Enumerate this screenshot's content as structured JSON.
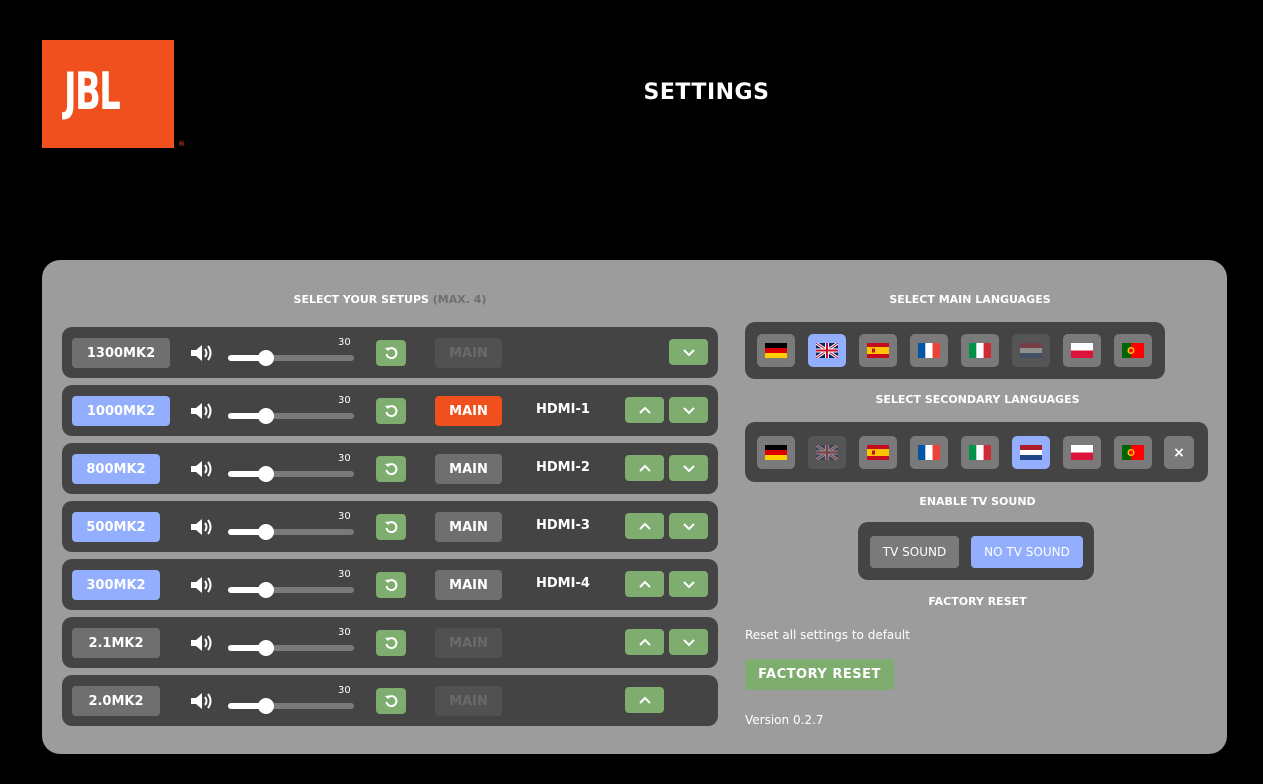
{
  "brand": {
    "logo_text": "JBL",
    "registered": "®"
  },
  "header": {
    "title": "SETTINGS"
  },
  "setups": {
    "title": "SELECT YOUR SETUPS",
    "title_note": "(MAX. 4)",
    "rows": [
      {
        "model": "1300MK2",
        "active": false,
        "volume": 30,
        "main_label": "MAIN",
        "main_state": "disabled",
        "hdmi": "",
        "up": false,
        "down": true
      },
      {
        "model": "1000MK2",
        "active": true,
        "volume": 30,
        "main_label": "MAIN",
        "main_state": "active",
        "hdmi": "HDMI-1",
        "up": true,
        "down": true
      },
      {
        "model": "800MK2",
        "active": true,
        "volume": 30,
        "main_label": "MAIN",
        "main_state": "normal",
        "hdmi": "HDMI-2",
        "up": true,
        "down": true
      },
      {
        "model": "500MK2",
        "active": true,
        "volume": 30,
        "main_label": "MAIN",
        "main_state": "normal",
        "hdmi": "HDMI-3",
        "up": true,
        "down": true
      },
      {
        "model": "300MK2",
        "active": true,
        "volume": 30,
        "main_label": "MAIN",
        "main_state": "normal",
        "hdmi": "HDMI-4",
        "up": true,
        "down": true
      },
      {
        "model": "2.1MK2",
        "active": false,
        "volume": 30,
        "main_label": "MAIN",
        "main_state": "disabled",
        "hdmi": "",
        "up": true,
        "down": true
      },
      {
        "model": "2.0MK2",
        "active": false,
        "volume": 30,
        "main_label": "MAIN",
        "main_state": "disabled",
        "hdmi": "",
        "up": true,
        "down": false
      }
    ]
  },
  "main_languages": {
    "title": "SELECT MAIN LANGUAGES",
    "flags": [
      {
        "name": "german",
        "state": "normal"
      },
      {
        "name": "uk",
        "state": "selected"
      },
      {
        "name": "spanish",
        "state": "normal"
      },
      {
        "name": "french",
        "state": "normal"
      },
      {
        "name": "italian",
        "state": "normal"
      },
      {
        "name": "dutch",
        "state": "dim"
      },
      {
        "name": "polish",
        "state": "normal"
      },
      {
        "name": "portuguese",
        "state": "normal"
      }
    ]
  },
  "secondary_languages": {
    "title": "SELECT SECONDARY LANGUAGES",
    "flags": [
      {
        "name": "german",
        "state": "normal"
      },
      {
        "name": "uk",
        "state": "dim"
      },
      {
        "name": "spanish",
        "state": "normal"
      },
      {
        "name": "french",
        "state": "normal"
      },
      {
        "name": "italian",
        "state": "normal"
      },
      {
        "name": "dutch",
        "state": "selected"
      },
      {
        "name": "polish",
        "state": "normal"
      },
      {
        "name": "portuguese",
        "state": "normal"
      }
    ],
    "clear_label": "×"
  },
  "tv_sound": {
    "title": "ENABLE TV SOUND",
    "tv_sound_label": "TV SOUND",
    "no_tv_sound_label": "NO TV SOUND",
    "selected": "no_tv_sound"
  },
  "factory_reset": {
    "title": "FACTORY RESET",
    "description": "Reset all settings to default",
    "button_label": "FACTORY RESET"
  },
  "version": "Version 0.2.7",
  "colors": {
    "brand_orange": "#f0501e",
    "active_blue": "#93aefd",
    "action_green": "#7fad6f",
    "panel_gray": "#9c9c9c",
    "row_dark": "#444444"
  }
}
